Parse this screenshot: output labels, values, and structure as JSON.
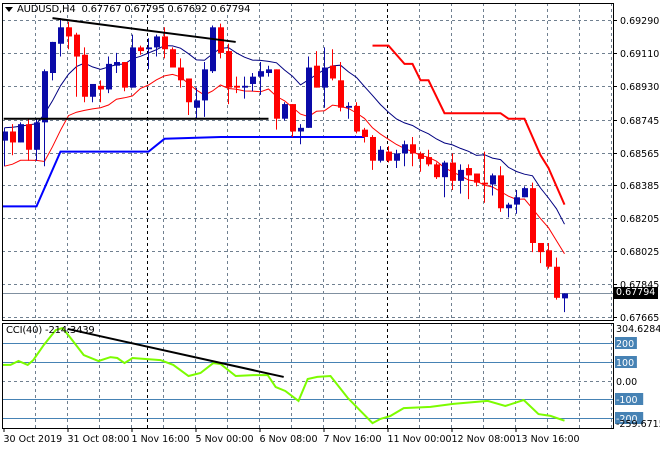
{
  "header": {
    "symbol": "AUDUSD,H4",
    "open": "0.67767",
    "high": "0.67795",
    "low": "0.67692",
    "close": "0.67794"
  },
  "indicator": {
    "name": "CCI(40)",
    "value": "-214.3439"
  },
  "colors": {
    "bull": "#0a0aa8",
    "bear": "#ff0000",
    "ma_high": "#000080",
    "ma_low": "#ff0000",
    "support": "#0000ff",
    "resistance": "#ff0000",
    "cci": "#7cfc00",
    "cci_levels": "#4682b4",
    "grid": "#708090"
  },
  "chart_data": [
    {
      "type": "candlestick",
      "title": "AUDUSD,H4",
      "ylim": [
        0.67665,
        0.6929
      ],
      "y_ticks": [
        "0.69290",
        "0.69110",
        "0.68930",
        "0.68745",
        "0.68565",
        "0.68385",
        "0.68205",
        "0.68025",
        "0.67845",
        "0.67665"
      ],
      "y_tick_values": [
        0.6929,
        0.6911,
        0.6893,
        0.68745,
        0.68565,
        0.68385,
        0.68205,
        0.68025,
        0.67845,
        0.67665
      ],
      "current_price": "0.67794",
      "x_labels": [
        {
          "index": 0,
          "label": "30 Oct 2019"
        },
        {
          "index": 8,
          "label": "31 Oct 08:00"
        },
        {
          "index": 16,
          "label": "1 Nov 16:00"
        },
        {
          "index": 24,
          "label": "5 Nov 00:00"
        },
        {
          "index": 32,
          "label": "6 Nov 08:00"
        },
        {
          "index": 40,
          "label": "7 Nov 16:00"
        },
        {
          "index": 48,
          "label": "11 Nov 00:00"
        },
        {
          "index": 56,
          "label": "12 Nov 08:00"
        },
        {
          "index": 64,
          "label": "13 Nov 16:00"
        }
      ],
      "ohlc": [
        [
          0.6863,
          0.687,
          0.6849,
          0.6868
        ],
        [
          0.6868,
          0.6872,
          0.6855,
          0.6862
        ],
        [
          0.6862,
          0.6873,
          0.6862,
          0.6872
        ],
        [
          0.6872,
          0.6875,
          0.6852,
          0.6858
        ],
        [
          0.6858,
          0.6875,
          0.6852,
          0.6873
        ],
        [
          0.6873,
          0.6902,
          0.6849,
          0.6901
        ],
        [
          0.69,
          0.6917,
          0.6896,
          0.6917
        ],
        [
          0.6916,
          0.693,
          0.6909,
          0.6925
        ],
        [
          0.6925,
          0.6928,
          0.6913,
          0.692
        ],
        [
          0.6921,
          0.6922,
          0.6887,
          0.6909
        ],
        [
          0.691,
          0.6914,
          0.6884,
          0.6887
        ],
        [
          0.6887,
          0.6894,
          0.6884,
          0.6894
        ],
        [
          0.6893,
          0.6896,
          0.6884,
          0.6891
        ],
        [
          0.6891,
          0.6909,
          0.6889,
          0.6905
        ],
        [
          0.6904,
          0.6911,
          0.69,
          0.6906
        ],
        [
          0.6906,
          0.6906,
          0.689,
          0.6892
        ],
        [
          0.6892,
          0.6921,
          0.6892,
          0.6914
        ],
        [
          0.6914,
          0.6915,
          0.691,
          0.6912
        ],
        [
          0.6913,
          0.6919,
          0.6902,
          0.6914
        ],
        [
          0.6914,
          0.6921,
          0.6909,
          0.692
        ],
        [
          0.692,
          0.6925,
          0.6908,
          0.6913
        ],
        [
          0.6913,
          0.6914,
          0.6903,
          0.6903
        ],
        [
          0.6903,
          0.6908,
          0.6892,
          0.6896
        ],
        [
          0.6897,
          0.6897,
          0.6877,
          0.6884
        ],
        [
          0.6881,
          0.6892,
          0.6875,
          0.6885
        ],
        [
          0.6885,
          0.6906,
          0.6876,
          0.6902
        ],
        [
          0.6901,
          0.6926,
          0.69,
          0.6925
        ],
        [
          0.6925,
          0.6927,
          0.6908,
          0.6911
        ],
        [
          0.6912,
          0.6916,
          0.6883,
          0.6892
        ],
        [
          0.6893,
          0.6898,
          0.6889,
          0.6892
        ],
        [
          0.6892,
          0.6898,
          0.6886,
          0.6893
        ],
        [
          0.6894,
          0.69,
          0.689,
          0.6898
        ],
        [
          0.6898,
          0.6906,
          0.6888,
          0.6901
        ],
        [
          0.69,
          0.6904,
          0.6898,
          0.6902
        ],
        [
          0.6902,
          0.6902,
          0.6869,
          0.6875
        ],
        [
          0.6875,
          0.6884,
          0.6874,
          0.6883
        ],
        [
          0.6883,
          0.6883,
          0.6865,
          0.6868
        ],
        [
          0.6868,
          0.6872,
          0.6861,
          0.687
        ],
        [
          0.687,
          0.6909,
          0.687,
          0.6903
        ],
        [
          0.6904,
          0.6912,
          0.6892,
          0.6892
        ],
        [
          0.6892,
          0.6914,
          0.6881,
          0.6903
        ],
        [
          0.6904,
          0.6913,
          0.6896,
          0.6897
        ],
        [
          0.6896,
          0.6906,
          0.6879,
          0.6881
        ],
        [
          0.6881,
          0.6884,
          0.6875,
          0.6882
        ],
        [
          0.6882,
          0.6884,
          0.6867,
          0.6868
        ],
        [
          0.6869,
          0.687,
          0.6862,
          0.6865
        ],
        [
          0.6865,
          0.6866,
          0.6847,
          0.6852
        ],
        [
          0.6852,
          0.686,
          0.6851,
          0.6858
        ],
        [
          0.6857,
          0.686,
          0.6851,
          0.6852
        ],
        [
          0.6852,
          0.6858,
          0.6848,
          0.6856
        ],
        [
          0.6856,
          0.6863,
          0.6849,
          0.6861
        ],
        [
          0.6861,
          0.6865,
          0.6849,
          0.6856
        ],
        [
          0.6856,
          0.6857,
          0.6846,
          0.6853
        ],
        [
          0.6854,
          0.6858,
          0.6849,
          0.685
        ],
        [
          0.685,
          0.6851,
          0.6842,
          0.6843
        ],
        [
          0.6843,
          0.6852,
          0.6832,
          0.6851
        ],
        [
          0.6851,
          0.6856,
          0.6836,
          0.6841
        ],
        [
          0.6841,
          0.685,
          0.6834,
          0.6847
        ],
        [
          0.6848,
          0.685,
          0.6831,
          0.6844
        ],
        [
          0.6845,
          0.6845,
          0.6838,
          0.684
        ],
        [
          0.684,
          0.6857,
          0.6829,
          0.6839
        ],
        [
          0.6839,
          0.6845,
          0.6833,
          0.6844
        ],
        [
          0.6844,
          0.6849,
          0.6824,
          0.6826
        ],
        [
          0.6826,
          0.6829,
          0.6821,
          0.6828
        ],
        [
          0.6828,
          0.6836,
          0.6823,
          0.6832
        ],
        [
          0.6832,
          0.6838,
          0.6832,
          0.6837
        ],
        [
          0.6837,
          0.684,
          0.6802,
          0.6807
        ],
        [
          0.6807,
          0.6807,
          0.6796,
          0.6802
        ],
        [
          0.6803,
          0.6807,
          0.6793,
          0.6794
        ],
        [
          0.6794,
          0.6799,
          0.6776,
          0.6777
        ],
        [
          0.67767,
          0.67795,
          0.67692,
          0.67794
        ]
      ],
      "support_line": [
        [
          0,
          0.6827
        ],
        [
          4,
          0.6827
        ],
        [
          7,
          0.6857
        ],
        [
          18,
          0.6857
        ],
        [
          20,
          0.6864
        ],
        [
          27,
          0.6865
        ],
        [
          45,
          0.6865
        ]
      ],
      "resistance_line": [
        [
          46,
          0.6915
        ],
        [
          48,
          0.6915
        ],
        [
          50,
          0.6905
        ],
        [
          51,
          0.6905
        ],
        [
          52,
          0.6896
        ],
        [
          53,
          0.6896
        ],
        [
          55,
          0.6878
        ],
        [
          62,
          0.6878
        ],
        [
          63,
          0.6875
        ],
        [
          65,
          0.6875
        ],
        [
          67,
          0.6855
        ],
        [
          68,
          0.6848
        ],
        [
          70,
          0.6828
        ]
      ],
      "trendlines": [
        {
          "from": [
            6,
            0.693
          ],
          "to": [
            28.9,
            0.6917
          ]
        },
        {
          "from": [
            -0.1,
            0.6875
          ],
          "to": [
            33,
            0.6875
          ]
        }
      ]
    },
    {
      "type": "line",
      "title": "CCI(40)",
      "ylim": [
        -259.6715,
        304.6284
      ],
      "y_ticks": [
        "304.6284",
        "200",
        "100",
        "0.00",
        "-100",
        "-200",
        "-259.6715"
      ],
      "levels": [
        200,
        100,
        0,
        -100,
        -200
      ],
      "points": [
        [
          -0.5,
          83
        ],
        [
          0.75,
          83
        ],
        [
          1.75,
          104
        ],
        [
          2.9,
          83
        ],
        [
          3.6,
          109
        ],
        [
          4.9,
          189
        ],
        [
          6.4,
          269
        ],
        [
          7.25,
          280
        ],
        [
          8.25,
          227
        ],
        [
          9.9,
          136
        ],
        [
          11.75,
          104
        ],
        [
          13.25,
          125
        ],
        [
          14.1,
          120
        ],
        [
          15,
          93
        ],
        [
          16,
          120
        ],
        [
          19.5,
          109
        ],
        [
          21.1,
          83
        ],
        [
          23,
          24
        ],
        [
          24.5,
          40
        ],
        [
          26.1,
          93
        ],
        [
          27,
          88
        ],
        [
          28.9,
          24
        ],
        [
          31.1,
          29
        ],
        [
          32.9,
          29
        ],
        [
          33.9,
          -35
        ],
        [
          35.1,
          -56
        ],
        [
          36.75,
          -109
        ],
        [
          37.9,
          8
        ],
        [
          39.1,
          19
        ],
        [
          40.75,
          24
        ],
        [
          42.9,
          -93
        ],
        [
          46,
          -227
        ],
        [
          47,
          -205
        ],
        [
          48.25,
          -189
        ],
        [
          49.9,
          -147
        ],
        [
          53.25,
          -141
        ],
        [
          56.1,
          -125
        ],
        [
          60.4,
          -109
        ],
        [
          62.6,
          -136
        ],
        [
          64.9,
          -104
        ],
        [
          66.75,
          -179
        ],
        [
          68.25,
          -189
        ],
        [
          70,
          -214.3439
        ]
      ],
      "trendline": {
        "from": [
          7.9,
          275
        ],
        "to": [
          34.9,
          19
        ]
      }
    }
  ]
}
